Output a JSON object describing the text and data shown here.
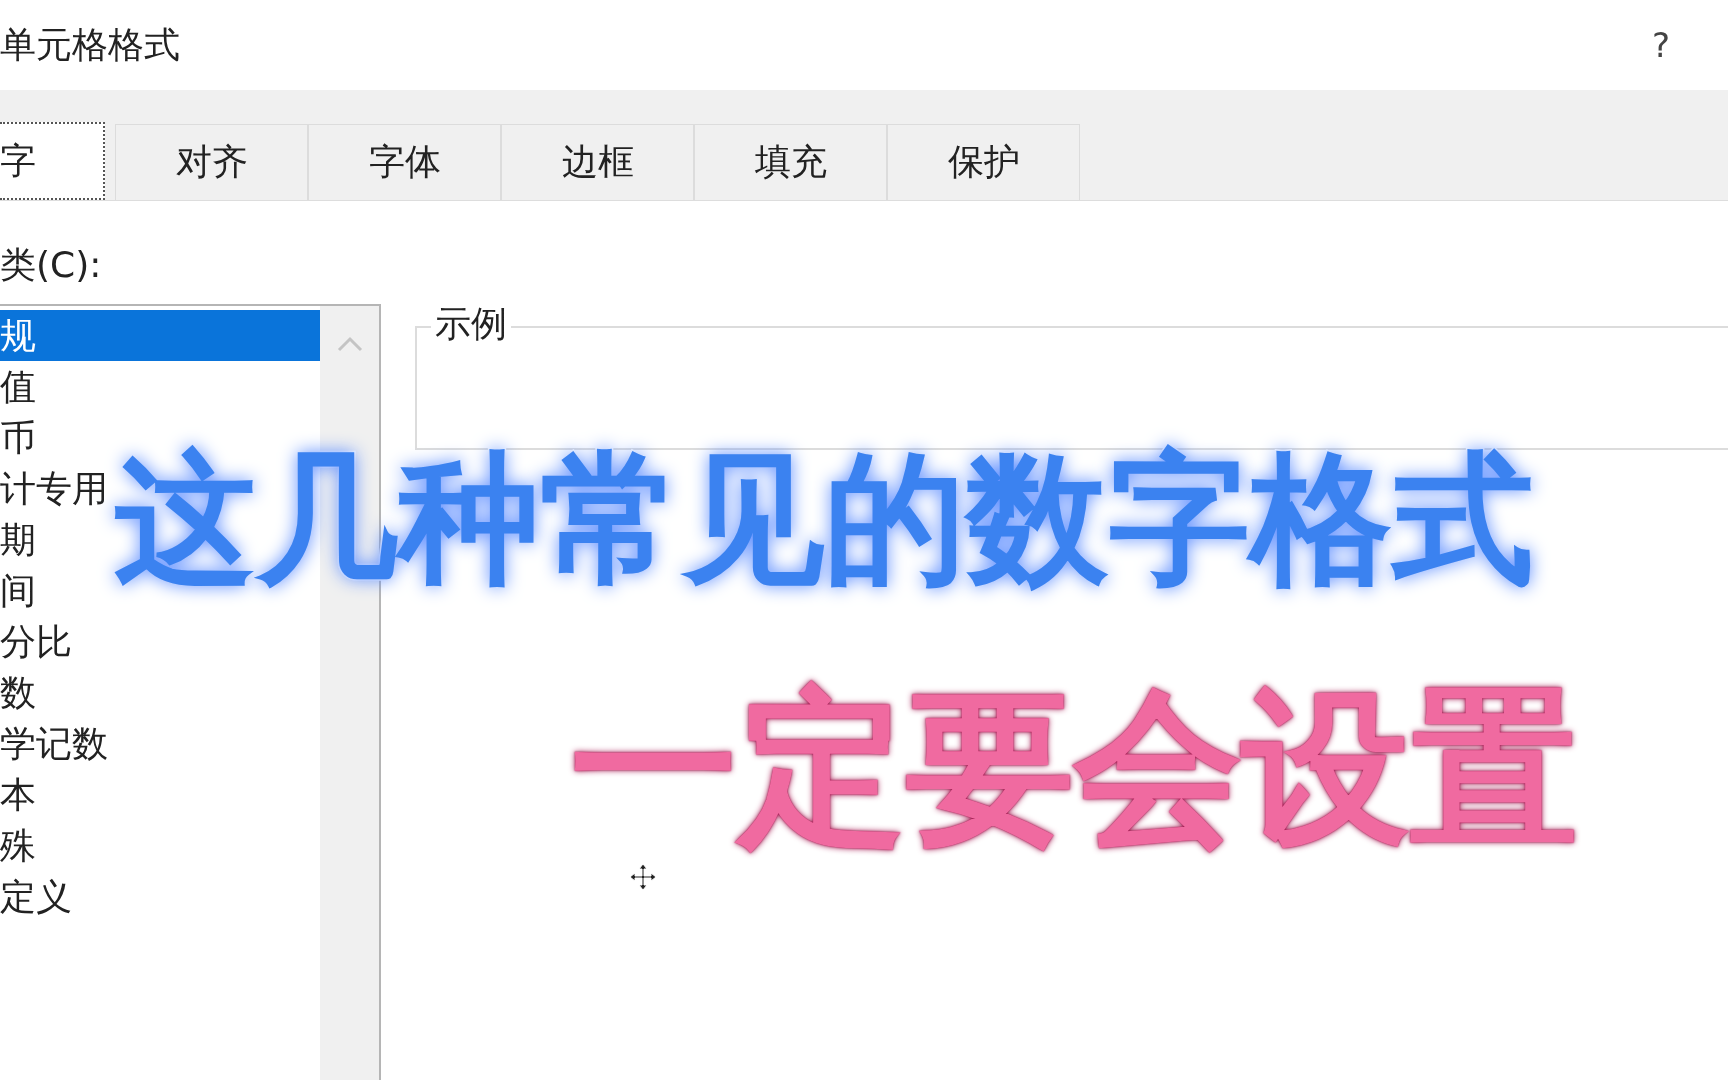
{
  "window": {
    "title": "单元格格式",
    "help": "?"
  },
  "tabs": [
    {
      "label": "字",
      "selected": true
    },
    {
      "label": "对齐",
      "selected": false
    },
    {
      "label": "字体",
      "selected": false
    },
    {
      "label": "边框",
      "selected": false
    },
    {
      "label": "填充",
      "selected": false
    },
    {
      "label": "保护",
      "selected": false
    }
  ],
  "category": {
    "label": "类(C):",
    "items": [
      {
        "label": "规",
        "selected": true
      },
      {
        "label": "值",
        "selected": false
      },
      {
        "label": "币",
        "selected": false
      },
      {
        "label": "计专用",
        "selected": false
      },
      {
        "label": "期",
        "selected": false
      },
      {
        "label": "间",
        "selected": false
      },
      {
        "label": "分比",
        "selected": false
      },
      {
        "label": "数",
        "selected": false
      },
      {
        "label": "学记数",
        "selected": false
      },
      {
        "label": "本",
        "selected": false
      },
      {
        "label": "殊",
        "selected": false
      },
      {
        "label": "定义",
        "selected": false
      }
    ]
  },
  "sample": {
    "label": "示例"
  },
  "captions": [
    {
      "text": "这几种常见的数字格式",
      "kind": "blue"
    },
    {
      "text": "一定要会设置",
      "kind": "pink"
    }
  ]
}
